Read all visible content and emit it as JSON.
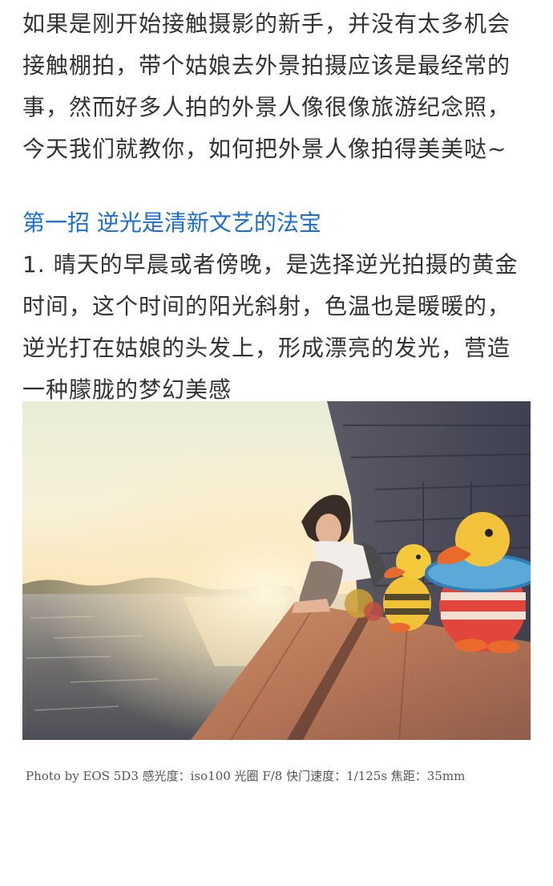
{
  "intro": {
    "lines": [
      "如果是刚开始接触摄影的新手，并没有太多机会",
      "接触棚拍，带个姑娘去外景拍摄应该是最经常的",
      "事，然而好多人拍的外景人像很像旅游纪念照，",
      "今天我们就教你，如何把外景人像拍得美美哒~"
    ]
  },
  "section": {
    "heading": "第一招 逆光是清新文艺的法宝",
    "heading_color": "#1a6fd6"
  },
  "tip1": {
    "lines": [
      "1. 晴天的早晨或者傍晚，是选择逆光拍摄的黄金",
      "时间，这个时间的阳光斜射，色温也是暖暖的，",
      "逆光打在姑娘的头发上，形成漂亮的发光，营造",
      "一种朦胧的梦幻美感"
    ]
  },
  "photo": {
    "caption": "Photo by EOS 5D3  感光度：iso100  光圈 F/8  快门速度：1/125s  焦距：35mm"
  }
}
